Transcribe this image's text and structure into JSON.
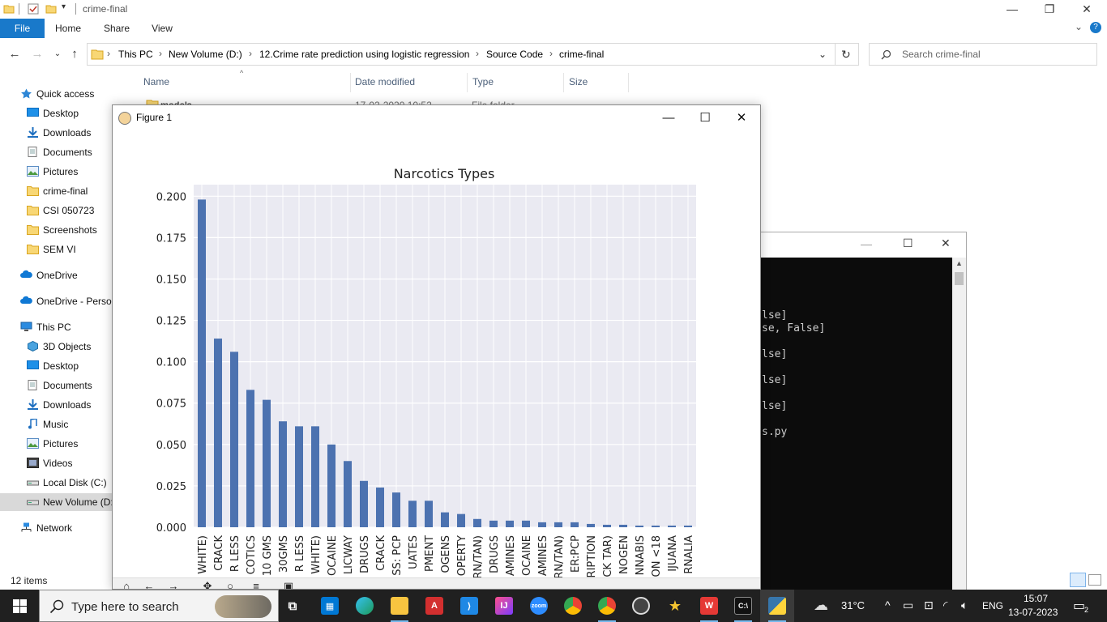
{
  "explorer": {
    "title": "crime-final",
    "ribbon_tabs": [
      "File",
      "Home",
      "Share",
      "View"
    ],
    "breadcrumb": [
      "This PC",
      "New Volume (D:)",
      "12.Crime rate prediction using logistic regression",
      "Source Code",
      "crime-final"
    ],
    "search_placeholder": "Search crime-final",
    "columns": [
      "Name",
      "Date modified",
      "Type",
      "Size"
    ],
    "partial_row": {
      "name": "models",
      "date": "17-02-2020 10:52",
      "type": "File folder"
    },
    "sidebar": [
      {
        "label": "Quick access",
        "icon": "star-icon",
        "level": "top"
      },
      {
        "label": "Desktop",
        "icon": "desktop-icon",
        "level": "sub"
      },
      {
        "label": "Downloads",
        "icon": "download-icon",
        "level": "sub"
      },
      {
        "label": "Documents",
        "icon": "documents-icon",
        "level": "sub"
      },
      {
        "label": "Pictures",
        "icon": "pictures-icon",
        "level": "sub"
      },
      {
        "label": "crime-final",
        "icon": "folder-icon",
        "level": "sub"
      },
      {
        "label": "CSI 050723",
        "icon": "folder-icon",
        "level": "sub"
      },
      {
        "label": "Screenshots",
        "icon": "folder-icon",
        "level": "sub"
      },
      {
        "label": "SEM VI",
        "icon": "folder-icon",
        "level": "sub"
      },
      {
        "label": "OneDrive",
        "icon": "cloud-icon",
        "level": "top"
      },
      {
        "label": "OneDrive - Personal",
        "icon": "cloud-icon",
        "level": "top"
      },
      {
        "label": "This PC",
        "icon": "computer-icon",
        "level": "top"
      },
      {
        "label": "3D Objects",
        "icon": "cube-icon",
        "level": "sub"
      },
      {
        "label": "Desktop",
        "icon": "desktop-icon",
        "level": "sub"
      },
      {
        "label": "Documents",
        "icon": "documents-icon",
        "level": "sub"
      },
      {
        "label": "Downloads",
        "icon": "download-icon",
        "level": "sub"
      },
      {
        "label": "Music",
        "icon": "music-icon",
        "level": "sub"
      },
      {
        "label": "Pictures",
        "icon": "pictures-icon",
        "level": "sub"
      },
      {
        "label": "Videos",
        "icon": "videos-icon",
        "level": "sub"
      },
      {
        "label": "Local Disk (C:)",
        "icon": "drive-icon",
        "level": "sub"
      },
      {
        "label": "New Volume (D:)",
        "icon": "drive-icon",
        "level": "sub",
        "selected": true
      },
      {
        "label": "Network",
        "icon": "network-icon",
        "level": "top"
      }
    ],
    "status": "12 items"
  },
  "console": {
    "lines": [
      "lse]",
      "se, False]",
      "lse]",
      "lse]",
      "lse]",
      "s.py"
    ]
  },
  "figure": {
    "title": "Figure 1"
  },
  "chart_data": {
    "type": "bar",
    "title": "Narcotics Types",
    "xlabel": "",
    "ylabel": "",
    "ylim": [
      0,
      0.207
    ],
    "yticks": [
      "0.000",
      "0.025",
      "0.050",
      "0.075",
      "0.100",
      "0.125",
      "0.150",
      "0.175",
      "0.200"
    ],
    "grid": true,
    "categories": [
      "WHITE)",
      "CRACK",
      "R LESS",
      "COTICS",
      "10 GMS",
      "30GMS",
      "R LESS",
      "WHITE)",
      "OCAINE",
      "LICWAY",
      "DRUGS",
      "CRACK",
      "SS: PCP",
      "UATES",
      "PMENT",
      "OGENS",
      "OPERTY",
      "RN/TAN)",
      "DRUGS",
      "AMINES",
      "OCAINE",
      "AMINES",
      "RN/TAN)",
      "ER:PCP",
      "RIPTION",
      "CK TAR)",
      "NOGEN",
      "NNABIS",
      "ON <18",
      "IJUANA",
      "RNALIA"
    ],
    "values": [
      0.198,
      0.114,
      0.106,
      0.083,
      0.077,
      0.064,
      0.061,
      0.061,
      0.05,
      0.04,
      0.028,
      0.024,
      0.021,
      0.016,
      0.016,
      0.009,
      0.008,
      0.005,
      0.004,
      0.004,
      0.004,
      0.003,
      0.003,
      0.003,
      0.002,
      0.0015,
      0.0015,
      0.001,
      0.001,
      0.001,
      0.001
    ],
    "bar_color": "#4c72b0",
    "background": "#eaeaf2"
  },
  "taskbar": {
    "search_placeholder": "Type here to search",
    "weather": "31°C",
    "language": "ENG",
    "time": "15:07",
    "date": "13-07-2023",
    "notification_count": "2"
  }
}
